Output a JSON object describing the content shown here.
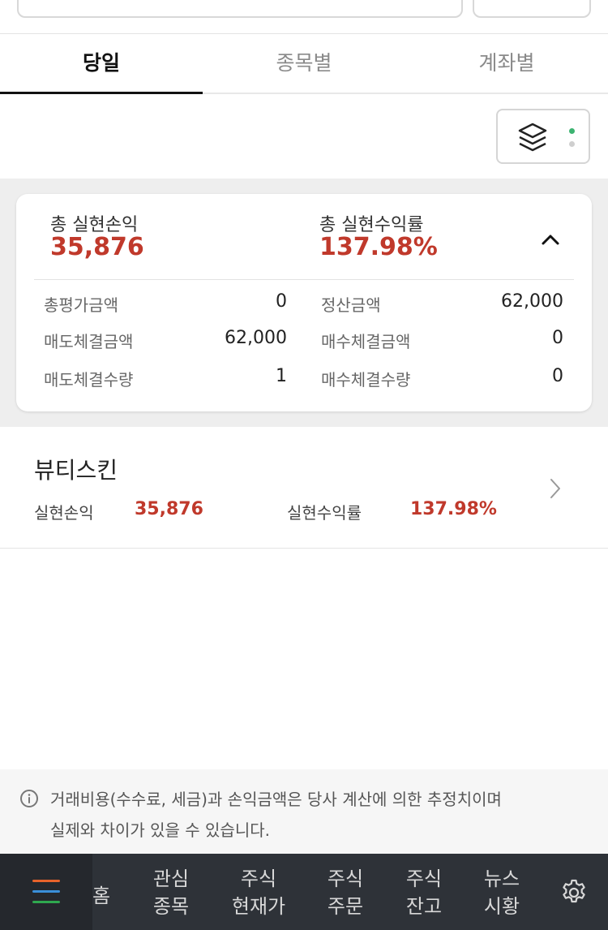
{
  "tabs": [
    {
      "label": "당일",
      "active": true
    },
    {
      "label": "종목별",
      "active": false
    },
    {
      "label": "계좌별",
      "active": false
    }
  ],
  "summary": {
    "total_realized_pl_label": "총 실현손익",
    "total_realized_pl_value": "35,876",
    "total_return_label": "총 실현수익률",
    "total_return_value": "137.98%",
    "rows": [
      {
        "left_label": "총평가금액",
        "left_value": "0",
        "right_label": "정산금액",
        "right_value": "62,000"
      },
      {
        "left_label": "매도체결금액",
        "left_value": "62,000",
        "right_label": "매수체결금액",
        "right_value": "0"
      },
      {
        "left_label": "매도체결수량",
        "left_value": "1",
        "right_label": "매수체결수량",
        "right_value": "0"
      }
    ]
  },
  "stock": {
    "name": "뷰티스킨",
    "pl_label": "실현손익",
    "pl_value": "35,876",
    "return_label": "실현수익률",
    "return_value": "137.98%"
  },
  "notice": {
    "line1": "거래비용(수수료, 세금)과 손익금액은 당사 계산에 의한 추정치이며",
    "line2": "실제와 차이가 있을 수 있습니다."
  },
  "nav": {
    "home": "홈",
    "items": [
      {
        "line1": "관심",
        "line2": "종목"
      },
      {
        "line1": "주식",
        "line2": "현재가"
      },
      {
        "line1": "주식",
        "line2": "주문"
      },
      {
        "line1": "주식",
        "line2": "잔고"
      },
      {
        "line1": "뉴스",
        "line2": "시황"
      }
    ]
  },
  "colors": {
    "accent_red": "#c0392b",
    "status_green": "#3cb371",
    "nav_bg": "#2e3238",
    "menu_bar_orange": "#e8632b",
    "menu_bar_blue": "#3a8fd9",
    "menu_bar_green": "#2fa84f"
  }
}
